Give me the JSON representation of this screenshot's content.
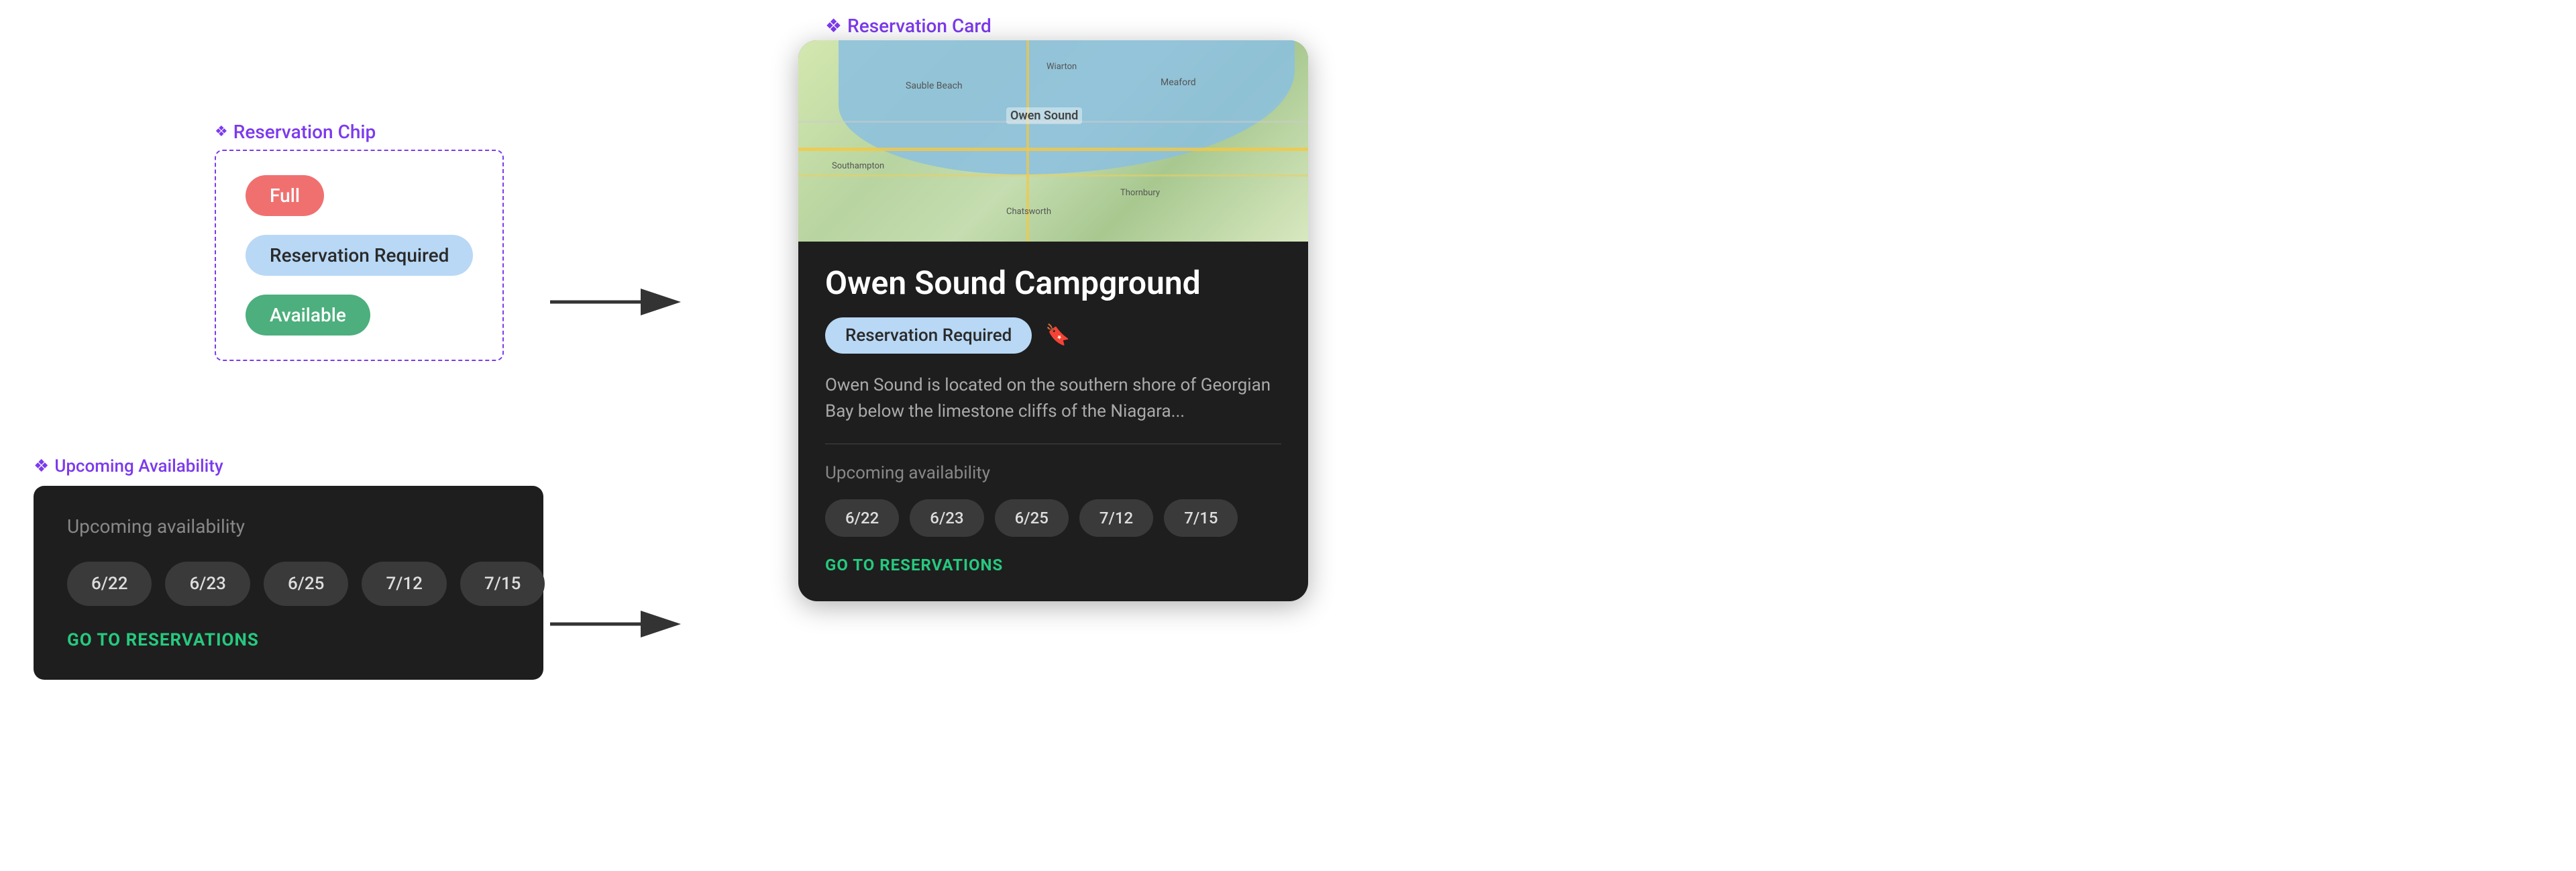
{
  "chipSection": {
    "label": "Reservation Chip",
    "diamond": "❖",
    "chips": [
      {
        "id": "full",
        "label": "Full",
        "type": "full"
      },
      {
        "id": "reservation",
        "label": "Reservation Required",
        "type": "reservation"
      },
      {
        "id": "available",
        "label": "Available",
        "type": "available"
      }
    ]
  },
  "availabilitySection": {
    "label": "Upcoming Availability",
    "diamond": "❖",
    "card": {
      "title": "Upcoming availability",
      "dates": [
        "6/22",
        "6/23",
        "6/25",
        "7/12",
        "7/15"
      ],
      "goToReservations": "GO TO RESERVATIONS"
    }
  },
  "reservationCardSection": {
    "label": "Reservation Card",
    "diamond": "❖",
    "card": {
      "title": "Owen Sound Campground",
      "chipLabel": "Reservation Required",
      "description": "Owen Sound is located on the southern shore of Georgian Bay below the limestone cliffs of the Niagara...",
      "availabilityTitle": "Upcoming availability",
      "dates": [
        "6/22",
        "6/23",
        "6/25",
        "7/12",
        "7/15"
      ],
      "goToReservations": "GO TO RESERVATIONS"
    }
  },
  "arrows": {
    "arrow1Label": "→",
    "arrow2Label": "→"
  },
  "colors": {
    "purple": "#7c3aed",
    "green": "#26c97e",
    "chipFull": "#f07070",
    "chipReservation": "#b8d8f5",
    "chipAvailable": "#4caf7d"
  }
}
